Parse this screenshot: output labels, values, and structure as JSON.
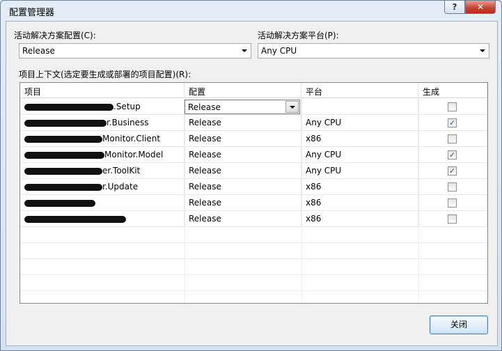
{
  "window": {
    "title": "配置管理器",
    "help_glyph": "?",
    "close_glyph": "✕"
  },
  "solution_config": {
    "label": "活动解决方案配置(C):",
    "value": "Release"
  },
  "solution_platform": {
    "label": "活动解决方案平台(P):",
    "value": "Any CPU"
  },
  "project_context_label": "项目上下文(选定要生成或部署的项目配置)(R):",
  "grid": {
    "columns": [
      "项目",
      "配置",
      "平台",
      "生成"
    ],
    "rows": [
      {
        "project": ".Setup",
        "config": "Release",
        "platform": "",
        "build": false,
        "editing": true
      },
      {
        "project": "r.Business",
        "config": "Release",
        "platform": "Any CPU",
        "build": true
      },
      {
        "project": "Monitor.Client",
        "config": "Release",
        "platform": "x86",
        "build": false
      },
      {
        "project": "Monitor.Model",
        "config": "Release",
        "platform": "Any CPU",
        "build": true
      },
      {
        "project": "er.ToolKit",
        "config": "Release",
        "platform": "Any CPU",
        "build": true
      },
      {
        "project": "r.Update",
        "config": "Release",
        "platform": "x86",
        "build": false
      },
      {
        "project": "",
        "config": "Release",
        "platform": "x86",
        "build": false
      },
      {
        "project": "",
        "config": "Release",
        "platform": "x86",
        "build": false
      }
    ]
  },
  "buttons": {
    "close_label": "关闭"
  },
  "check_glyph": "✓"
}
